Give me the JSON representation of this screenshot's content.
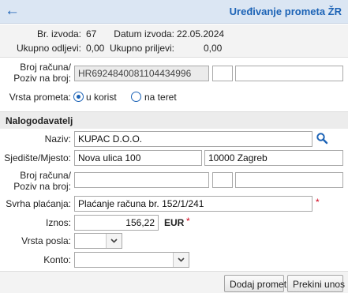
{
  "header": {
    "title": "Uređivanje prometa ŽR",
    "back_icon": "arrow-left-icon"
  },
  "summary": {
    "statement_no_label": "Br. izvoda:",
    "statement_no": "67",
    "date_label": "Datum izvoda:",
    "date": "22.05.2024",
    "outflow_label": "Ukupno odljevi:",
    "outflow": "0,00",
    "inflow_label": "Ukupno priljevi:",
    "inflow": "0,00"
  },
  "account": {
    "label_line1": "Broj računa/",
    "label_line2": "Poziv na broj:",
    "value": "HR6924840081104434996",
    "model": "",
    "reference": ""
  },
  "transaction_type": {
    "label": "Vrsta prometa:",
    "options": [
      {
        "label": "u korist",
        "selected": true
      },
      {
        "label": "na teret",
        "selected": false
      }
    ]
  },
  "section": {
    "title": "Nalogodavatelj"
  },
  "payer": {
    "name_label": "Naziv:",
    "name": "KUPAC D.O.O.",
    "address_label": "Sjedište/Mjesto:",
    "street": "Nova ulica 100",
    "city": "10000 Zagreb",
    "account_label_line1": "Broj računa/",
    "account_label_line2": "Poziv na broj:",
    "account": "",
    "model": "",
    "reference": "",
    "purpose_label": "Svrha plaćanja:",
    "purpose": "Plaćanje računa br. 152/1/241",
    "amount_label": "Iznos:",
    "amount": "156,22",
    "currency": "EUR",
    "business_type_label": "Vrsta posla:",
    "business_type": "",
    "konto_label": "Konto:",
    "konto": ""
  },
  "required_marker": "*",
  "buttons": {
    "add": "Dodaj promet",
    "cancel": "Prekini unos"
  },
  "colors": {
    "accent": "#1c63b6",
    "header_bg": "#dbe6f3",
    "required": "#d0021b"
  }
}
